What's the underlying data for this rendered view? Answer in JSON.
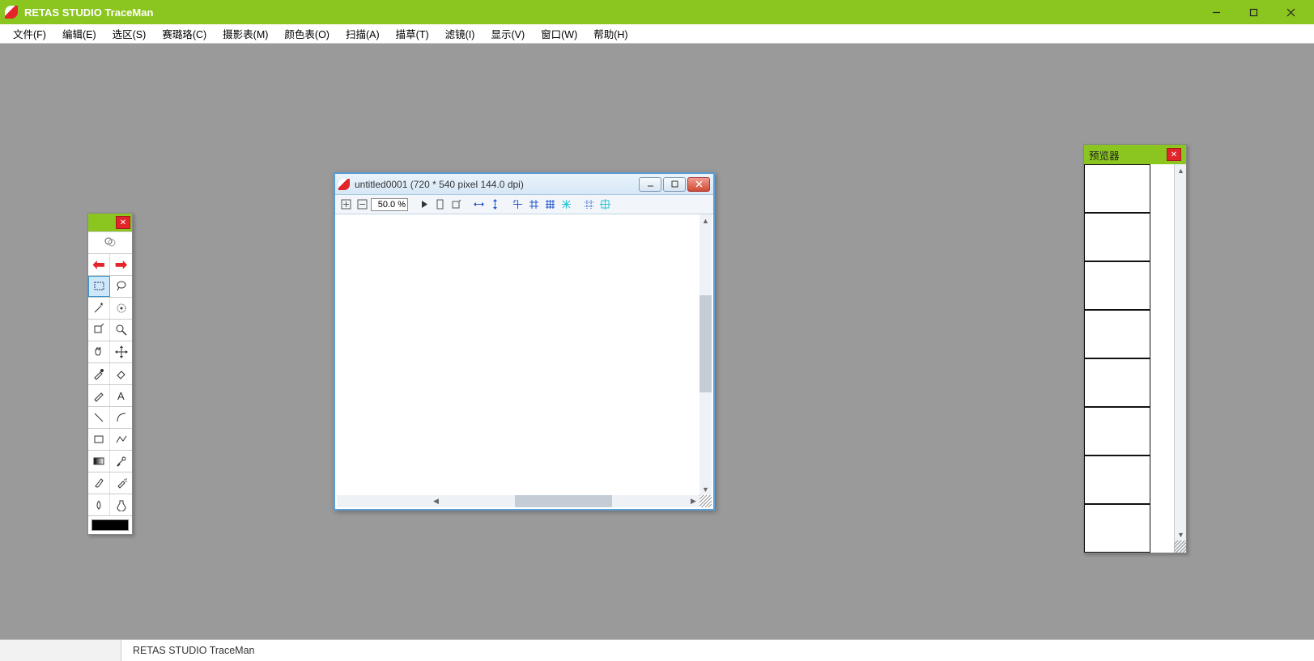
{
  "app": {
    "title": "RETAS STUDIO TraceMan"
  },
  "menu": {
    "file": "文件(F)",
    "edit": "编辑(E)",
    "select": "选区(S)",
    "cel": "赛璐珞(C)",
    "xsheet": "摄影表(M)",
    "color": "颜色表(O)",
    "scan": "扫描(A)",
    "trace": "描草(T)",
    "filter": "滤镜(I)",
    "view": "显示(V)",
    "window": "窗口(W)",
    "help": "帮助(H)"
  },
  "doc": {
    "title": "untitled0001 (720 * 540 pixel 144.0 dpi)",
    "zoom": "50.0 %"
  },
  "preview": {
    "title": "预览器",
    "thumb_count": 8
  },
  "toolbox": {
    "tools": [
      [
        "onion-skin"
      ],
      [
        "nav-prev",
        "nav-next"
      ],
      [
        "marquee",
        "lasso"
      ],
      [
        "magic-wand",
        "color-select"
      ],
      [
        "magnet",
        "zoom"
      ],
      [
        "hand",
        "move"
      ],
      [
        "eyedropper",
        "eraser"
      ],
      [
        "pencil",
        "text"
      ],
      [
        "line",
        "curve"
      ],
      [
        "rectangle",
        "polyline"
      ],
      [
        "gradient",
        "brush-adjust"
      ],
      [
        "brush",
        "airbrush"
      ],
      [
        "drop",
        "potion"
      ]
    ]
  },
  "taskbar": {
    "item": "RETAS STUDIO TraceMan"
  },
  "colors": {
    "accent": "#8bc520",
    "danger": "#e3252a",
    "frame": "#5a9ed6"
  }
}
